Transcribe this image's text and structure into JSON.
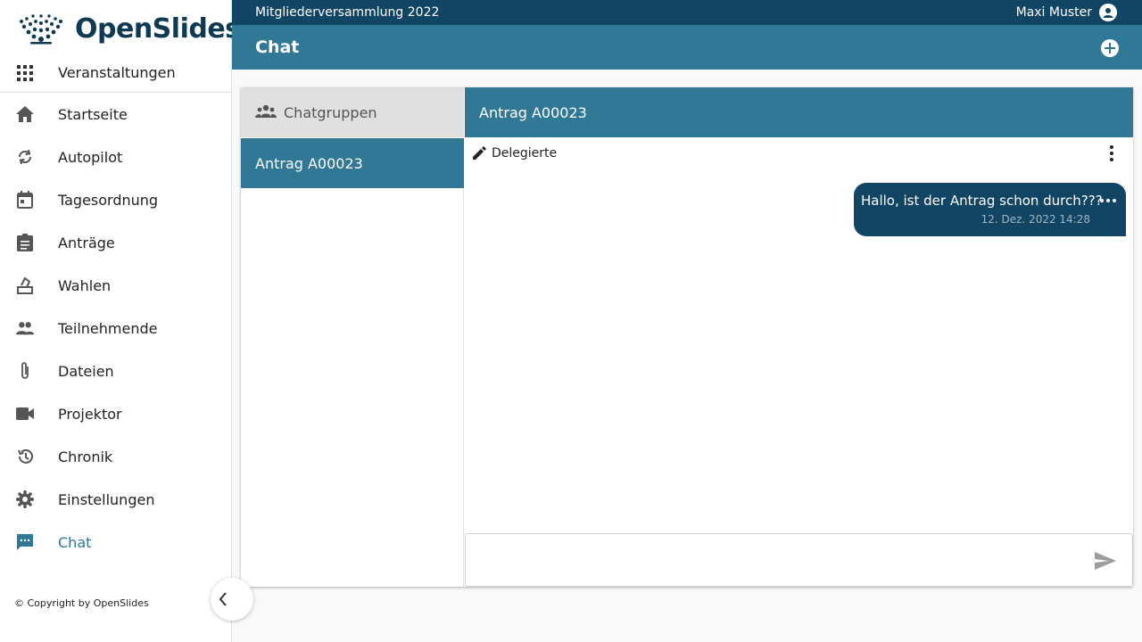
{
  "app": {
    "logo_text": "OpenSlides"
  },
  "topbar": {
    "meeting_name": "Mitgliederversammlung 2022",
    "user_name": "Maxi Muster"
  },
  "header": {
    "title": "Chat"
  },
  "sidebar": {
    "events_label": "Veranstaltungen",
    "items": [
      {
        "label": "Startseite",
        "icon": "home-icon"
      },
      {
        "label": "Autopilot",
        "icon": "sync-icon"
      },
      {
        "label": "Tagesordnung",
        "icon": "calendar-icon"
      },
      {
        "label": "Anträge",
        "icon": "assignment-icon"
      },
      {
        "label": "Wahlen",
        "icon": "ballot-icon"
      },
      {
        "label": "Teilnehmende",
        "icon": "people-icon"
      },
      {
        "label": "Dateien",
        "icon": "attachment-icon"
      },
      {
        "label": "Projektor",
        "icon": "videocam-icon"
      },
      {
        "label": "Chronik",
        "icon": "history-icon"
      },
      {
        "label": "Einstellungen",
        "icon": "gear-icon"
      },
      {
        "label": "Chat",
        "icon": "chat-icon",
        "active": true
      }
    ],
    "copyright": "©  Copyright by OpenSlides"
  },
  "chat": {
    "groups_header": "Chatgruppen",
    "groups": [
      {
        "name": "Antrag A00023",
        "selected": true
      }
    ],
    "active_group": {
      "title": "Antrag A00023",
      "edit_label": "Delegierte",
      "messages": [
        {
          "text": "Hallo, ist der Antrag schon durch???",
          "time": "12. Dez. 2022 14:28",
          "own": true
        }
      ]
    },
    "composer": {
      "value": "",
      "placeholder": ""
    }
  },
  "colors": {
    "primary": "#317796",
    "dark": "#124563",
    "accent": "#0f3a52"
  }
}
